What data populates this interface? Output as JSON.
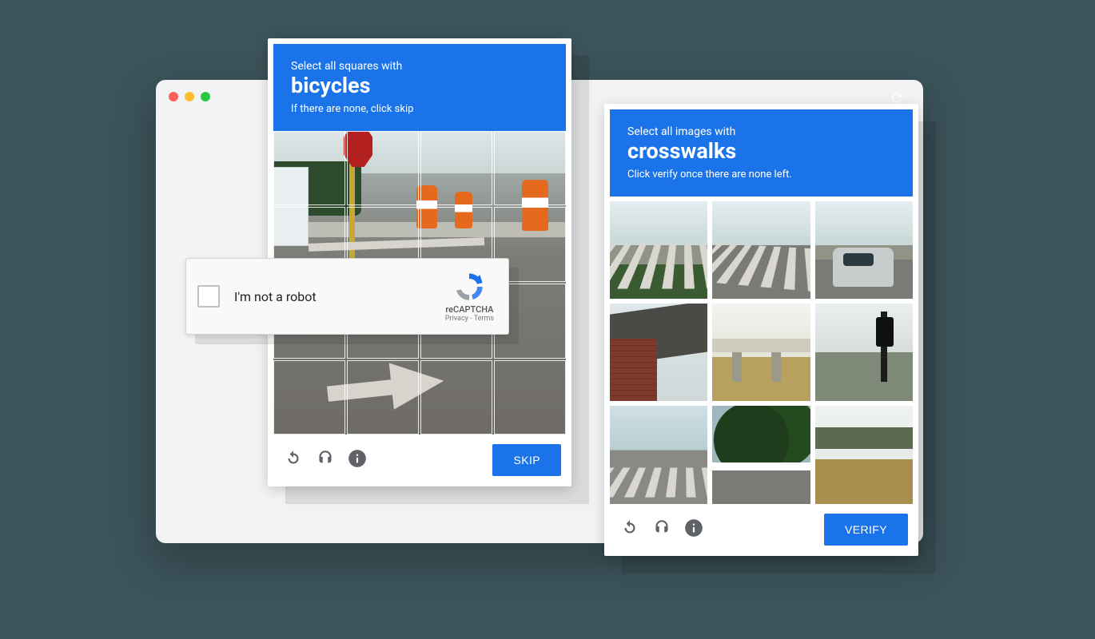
{
  "robot_card": {
    "label": "I'm not a robot",
    "brand": "reCAPTCHA",
    "links": "Privacy - Terms"
  },
  "challenge_left": {
    "prompt_line1": "Select all squares with",
    "target": "bicycles",
    "prompt_line2": "If there are none, click skip",
    "action": "SKIP"
  },
  "challenge_right": {
    "prompt_line1": "Select all images with",
    "target": "crosswalks",
    "prompt_line2": "Click verify once there are none left.",
    "action": "VERIFY"
  },
  "icons": {
    "reload": "reload-icon",
    "audio": "audio-icon",
    "info": "info-icon"
  }
}
